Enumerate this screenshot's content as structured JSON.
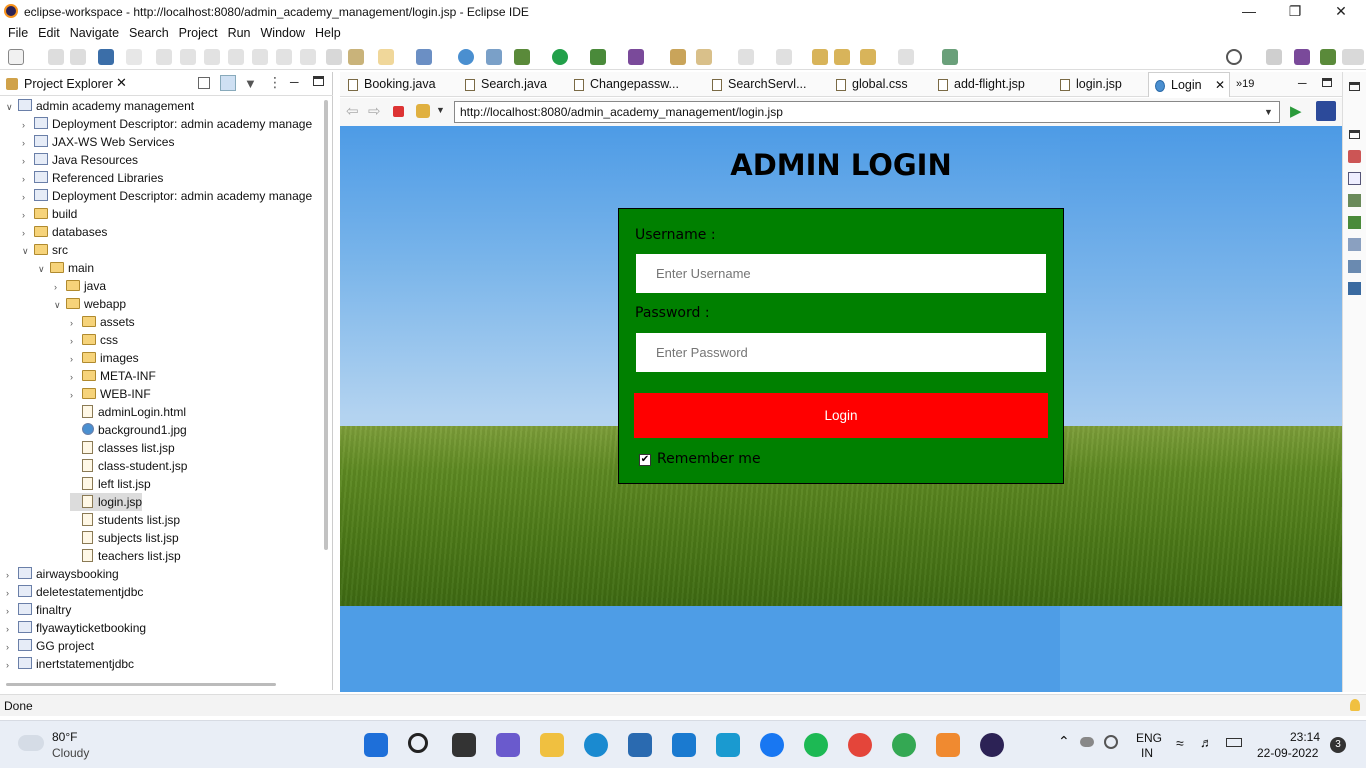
{
  "window": {
    "title": "eclipse-workspace - http://localhost:8080/admin_academy_management/login.jsp - Eclipse IDE"
  },
  "menu": [
    "File",
    "Edit",
    "Navigate",
    "Search",
    "Project",
    "Run",
    "Window",
    "Help"
  ],
  "project_explorer": {
    "title": "Project Explorer",
    "items": [
      {
        "label": "admin academy management",
        "depth": 0,
        "tw": "v",
        "icon": "project"
      },
      {
        "label": "Deployment Descriptor: admin academy manage",
        "depth": 1,
        "tw": ">",
        "icon": "descriptor"
      },
      {
        "label": "JAX-WS Web Services",
        "depth": 1,
        "tw": ">",
        "icon": "package"
      },
      {
        "label": "Java Resources",
        "depth": 1,
        "tw": ">",
        "icon": "package"
      },
      {
        "label": "Referenced Libraries",
        "depth": 1,
        "tw": ">",
        "icon": "package"
      },
      {
        "label": "Deployment Descriptor: admin academy manage",
        "depth": 1,
        "tw": ">",
        "icon": "descriptor"
      },
      {
        "label": "build",
        "depth": 1,
        "tw": ">",
        "icon": "folder"
      },
      {
        "label": "databases",
        "depth": 1,
        "tw": ">",
        "icon": "folder"
      },
      {
        "label": "src",
        "depth": 1,
        "tw": "v",
        "icon": "folder"
      },
      {
        "label": "main",
        "depth": 2,
        "tw": "v",
        "icon": "folder"
      },
      {
        "label": "java",
        "depth": 3,
        "tw": ">",
        "icon": "folder"
      },
      {
        "label": "webapp",
        "depth": 3,
        "tw": "v",
        "icon": "folder"
      },
      {
        "label": "assets",
        "depth": 4,
        "tw": ">",
        "icon": "folder"
      },
      {
        "label": "css",
        "depth": 4,
        "tw": ">",
        "icon": "folder"
      },
      {
        "label": "images",
        "depth": 4,
        "tw": ">",
        "icon": "folder"
      },
      {
        "label": "META-INF",
        "depth": 4,
        "tw": ">",
        "icon": "folder"
      },
      {
        "label": "WEB-INF",
        "depth": 4,
        "tw": ">",
        "icon": "folder"
      },
      {
        "label": "adminLogin.html",
        "depth": 4,
        "tw": "",
        "icon": "file"
      },
      {
        "label": "background1.jpg",
        "depth": 4,
        "tw": "",
        "icon": "image"
      },
      {
        "label": "classes list.jsp",
        "depth": 4,
        "tw": "",
        "icon": "file"
      },
      {
        "label": "class-student.jsp",
        "depth": 4,
        "tw": "",
        "icon": "file"
      },
      {
        "label": "left list.jsp",
        "depth": 4,
        "tw": "",
        "icon": "file"
      },
      {
        "label": "login.jsp",
        "depth": 4,
        "tw": "",
        "icon": "file",
        "selected": true
      },
      {
        "label": "students list.jsp",
        "depth": 4,
        "tw": "",
        "icon": "file"
      },
      {
        "label": "subjects list.jsp",
        "depth": 4,
        "tw": "",
        "icon": "file"
      },
      {
        "label": "teachers list.jsp",
        "depth": 4,
        "tw": "",
        "icon": "file"
      },
      {
        "label": "airwaysbooking",
        "depth": 0,
        "tw": ">",
        "icon": "project"
      },
      {
        "label": "deletestatementjdbc",
        "depth": 0,
        "tw": ">",
        "icon": "project"
      },
      {
        "label": "finaltry",
        "depth": 0,
        "tw": ">",
        "icon": "project"
      },
      {
        "label": "flyawayticketbooking",
        "depth": 0,
        "tw": ">",
        "icon": "project"
      },
      {
        "label": "GG project",
        "depth": 0,
        "tw": ">",
        "icon": "project"
      },
      {
        "label": "inertstatementjdbc",
        "depth": 0,
        "tw": ">",
        "icon": "project"
      }
    ]
  },
  "editor_tabs": [
    {
      "label": "Booking.java"
    },
    {
      "label": "Search.java"
    },
    {
      "label": "Changepassw..."
    },
    {
      "label": "SearchServl..."
    },
    {
      "label": "global.css"
    },
    {
      "label": "add-flight.jsp"
    },
    {
      "label": "login.jsp"
    },
    {
      "label": "Login",
      "active": true
    }
  ],
  "overflow_tabs": "»19",
  "browser": {
    "url": "http://localhost:8080/admin_academy_management/login.jsp"
  },
  "page": {
    "title": "ADMIN LOGIN",
    "username_label": "Username :",
    "username_placeholder": "Enter Username",
    "password_label": "Password :",
    "password_placeholder": "Enter Password",
    "login_button": "Login",
    "remember_label": "Remember me",
    "remember_checked": true
  },
  "status": {
    "text": "Done"
  },
  "weather": {
    "temp": "80°F",
    "condition": "Cloudy"
  },
  "tray": {
    "lang1": "ENG",
    "lang2": "IN",
    "time": "23:14",
    "date": "22-09-2022",
    "notifications": "3"
  },
  "colors": {
    "login_box": "#008000",
    "login_button": "#ff0000"
  }
}
